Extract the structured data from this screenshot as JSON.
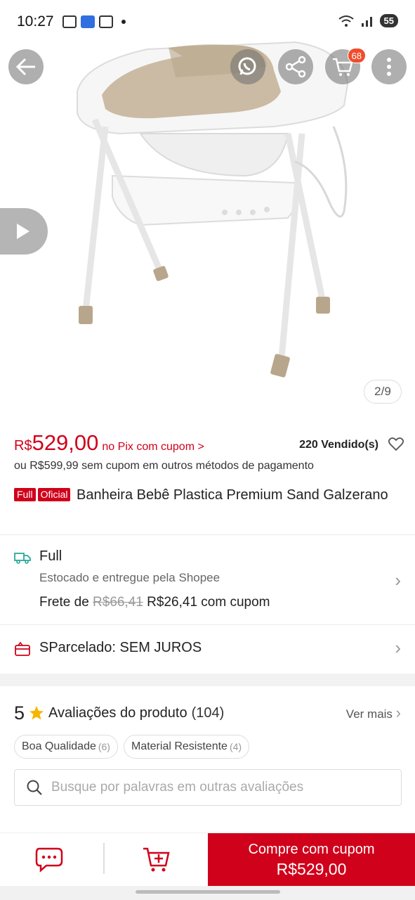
{
  "status_bar": {
    "time": "10:27",
    "battery": "55"
  },
  "header": {
    "back_icon": "arrow-left-icon",
    "whatsapp_icon": "whatsapp-icon",
    "share_icon": "share-icon",
    "cart_icon": "cart-icon",
    "cart_badge": "68",
    "more_icon": "more-vertical-icon"
  },
  "gallery": {
    "counter": "2/9",
    "video_icon": "play-icon"
  },
  "price": {
    "currency": "R$",
    "value": "529,00",
    "pix_link": "no Pix com cupom >",
    "sold": "220 Vendido(s)",
    "alternative": "ou R$599,99 sem cupom em outros métodos de pagamento"
  },
  "product": {
    "tag_full": "Full",
    "tag_official": "Oficial",
    "title": "Banheira Bebê Plastica Premium Sand Galzerano"
  },
  "shipping": {
    "label": "Full",
    "subtitle": "Estocado e entregue pela Shopee",
    "fee_prefix": "Frete de",
    "fee_old": "R$66,41",
    "fee_new": "R$26,41 com cupom"
  },
  "installment": {
    "label": "SParcelado: SEM JUROS"
  },
  "reviews": {
    "rating": "5",
    "title": "Avaliações do produto",
    "count": "(104)",
    "see_more": "Ver mais",
    "chips": [
      {
        "label": "Boa Qualidade",
        "count": "(6)"
      },
      {
        "label": "Material Resistente",
        "count": "(4)"
      }
    ],
    "search_placeholder": "Busque por palavras em outras avaliações"
  },
  "bottom_bar": {
    "buy_line1": "Compre com cupom",
    "buy_line2": "R$529,00"
  },
  "colors": {
    "accent": "#d0011b",
    "shopee_orange": "#ee4d2d",
    "text": "#222222"
  }
}
